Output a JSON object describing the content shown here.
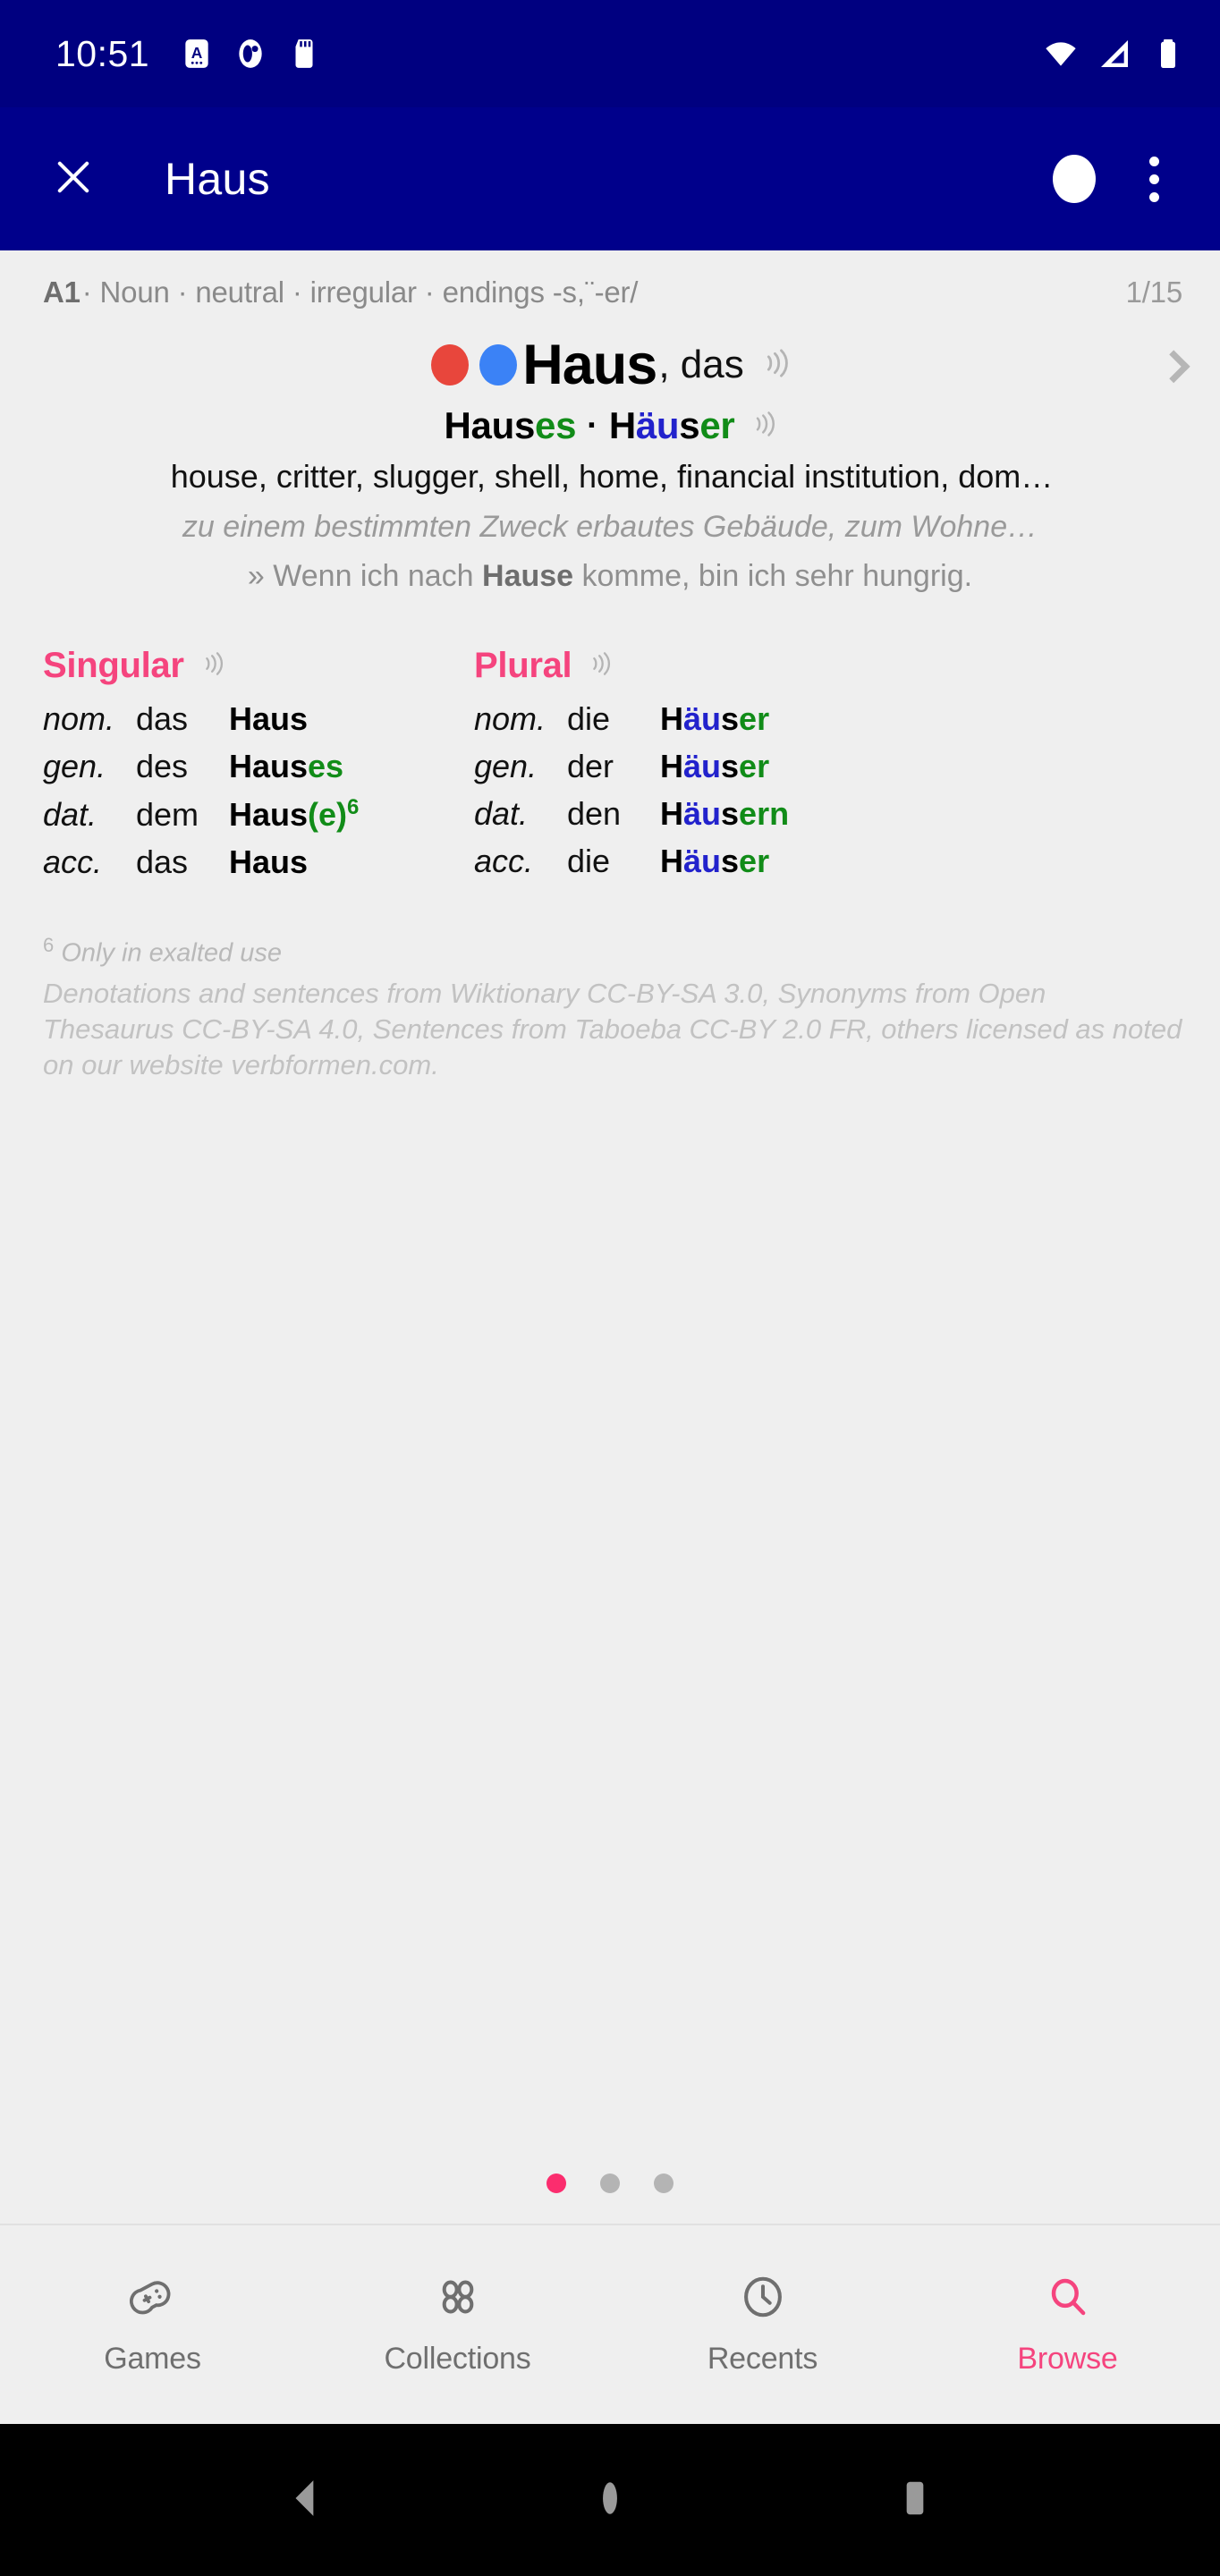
{
  "status_bar": {
    "time": "10:51",
    "left_icons": [
      "alarm-icon",
      "do-not-disturb-icon",
      "sd-card-icon"
    ],
    "right_icons": [
      "wifi-icon",
      "cellular-signal-icon",
      "battery-icon"
    ],
    "background": "#000080"
  },
  "app_bar": {
    "close_label": "✕",
    "title": "Haus",
    "record_icon": "record-circle-icon",
    "overflow_icon": "overflow-menu-icon",
    "background": "#00008B"
  },
  "entry": {
    "meta": {
      "level": "A1",
      "details": " · Noun · neutral · irregular · endings -s,¨-er/",
      "counter": "1/15"
    },
    "headword": {
      "markers": [
        "#e8463c",
        "#3b82f6"
      ],
      "word": "Haus",
      "article": ", das",
      "audio_icon": "speaker-icon",
      "chevron_icon": "chevron-right-icon"
    },
    "principal_forms": {
      "genitive": {
        "stem": "Haus",
        "ending": "es"
      },
      "separator": "·",
      "plural": {
        "pre": "H",
        "umlaut": "äu",
        "mid": "s",
        "ending": "er"
      },
      "audio_icon": "speaker-icon"
    },
    "translations": "house, critter, slugger, shell, home, financial institution, dom…",
    "definition": "zu einem bestimmten Zweck erbautes Gebäude, zum Wohne…",
    "example": {
      "prefix": "» Wenn ich nach ",
      "bold": "Hause",
      "suffix": " komme, bin ich sehr hungrig."
    }
  },
  "declension": {
    "accent_color": "#f5447e",
    "singular": {
      "title": "Singular",
      "audio_icon": "speaker-icon",
      "rows": [
        {
          "case": "nom.",
          "article": "das",
          "form_plain": "Haus",
          "form_green": "",
          "form_blue": "",
          "footnote": ""
        },
        {
          "case": "gen.",
          "article": "des",
          "form_plain": "Haus",
          "form_green": "es",
          "form_blue": "",
          "footnote": ""
        },
        {
          "case": "dat.",
          "article": "dem",
          "form_plain": "Haus",
          "form_green": "(e)",
          "form_blue": "",
          "footnote": "6"
        },
        {
          "case": "acc.",
          "article": "das",
          "form_plain": "Haus",
          "form_green": "",
          "form_blue": "",
          "footnote": ""
        }
      ]
    },
    "plural": {
      "title": "Plural",
      "audio_icon": "speaker-icon",
      "rows": [
        {
          "case": "nom.",
          "article": "die",
          "pre": "H",
          "umlaut": "äu",
          "mid": "s",
          "ending": "er"
        },
        {
          "case": "gen.",
          "article": "der",
          "pre": "H",
          "umlaut": "äu",
          "mid": "s",
          "ending": "er"
        },
        {
          "case": "dat.",
          "article": "den",
          "pre": "H",
          "umlaut": "äu",
          "mid": "s",
          "ending": "ern"
        },
        {
          "case": "acc.",
          "article": "die",
          "pre": "H",
          "umlaut": "äu",
          "mid": "s",
          "ending": "er"
        }
      ]
    }
  },
  "footnotes": {
    "marker": "6",
    "text": "Only in exalted use",
    "license": "Denotations and sentences from Wiktionary CC-BY-SA 3.0, Synonyms from Open Thesaurus CC-BY-SA 4.0, Sentences from Taboeba CC-BY 2.0 FR, others licensed as noted on our website verbformen.com."
  },
  "pager": {
    "total": 3,
    "active_index": 0,
    "active_color": "#fb2d6e",
    "inactive_color": "#b4b4b4"
  },
  "bottom_nav": {
    "items": [
      {
        "label": "Games",
        "icon": "gamepad-icon",
        "active": false
      },
      {
        "label": "Collections",
        "icon": "grid-circles-icon",
        "active": false
      },
      {
        "label": "Recents",
        "icon": "clock-icon",
        "active": false
      },
      {
        "label": "Browse",
        "icon": "search-icon",
        "active": true
      }
    ]
  },
  "system_nav": {
    "back_icon": "triangle-back-icon",
    "home_icon": "circle-home-icon",
    "recents_icon": "square-recents-icon"
  }
}
